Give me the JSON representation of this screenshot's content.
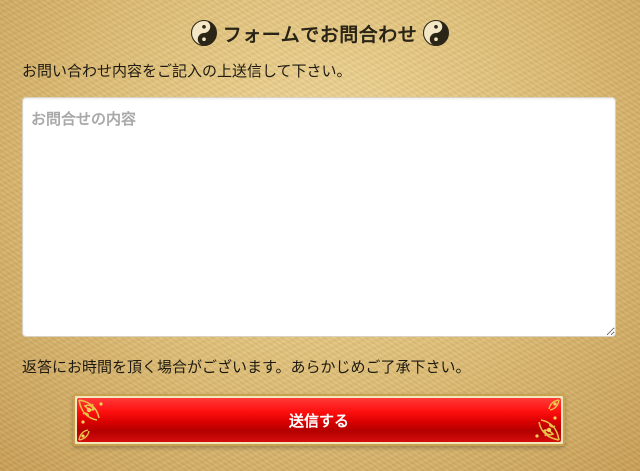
{
  "heading": {
    "title": "フォームでお問合わせ",
    "icon": "yin-yang-icon"
  },
  "form": {
    "instruction": "お問い合わせ内容をご記入の上送信して下さい。",
    "message_placeholder": "お問合せの内容",
    "message_value": "",
    "note": "返答にお時間を頂く場合がございます。あらかじめご了承下さい。",
    "submit_label": "送信する"
  },
  "colors": {
    "button_red": "#e00000",
    "button_text": "#ffffff",
    "background_gold": "#e2c27a",
    "ornament_gold": "#d9ad3c"
  }
}
